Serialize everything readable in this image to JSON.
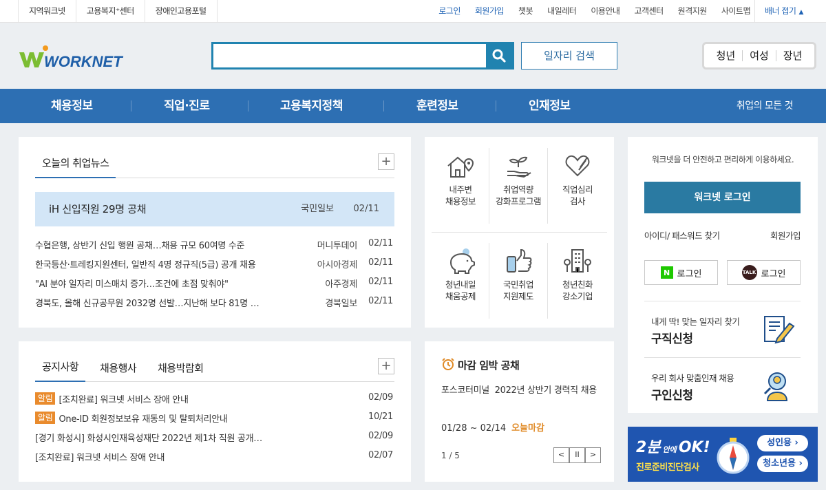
{
  "util": {
    "sites": [
      "지역워크넷",
      "고용복지⁺센터",
      "장애인고용포털"
    ],
    "links": [
      {
        "label": "로그인",
        "highlight": true
      },
      {
        "label": "회원가입",
        "highlight": true
      },
      {
        "label": "챗봇",
        "highlight": false
      },
      {
        "label": "내일레터",
        "highlight": false
      },
      {
        "label": "이용안내",
        "highlight": false
      },
      {
        "label": "고객센터",
        "highlight": false
      },
      {
        "label": "원격지원",
        "highlight": false
      },
      {
        "label": "사이트맵",
        "highlight": false
      }
    ],
    "banner_toggle": "배너 접기"
  },
  "header": {
    "logo": "WORKNET",
    "search_value": "",
    "search_button": "search-icon",
    "job_search": "일자리 검색",
    "age_links": [
      "청년",
      "여성",
      "장년"
    ]
  },
  "gnb": {
    "items": [
      "채용정보",
      "직업·진로",
      "고용복지정책",
      "훈련정보",
      "인재정보"
    ],
    "all": "취업의 모든 것"
  },
  "news": {
    "tab": "오늘의 취업뉴스",
    "more": "+",
    "headline": {
      "title": "iH 신입직원 29명 공채",
      "source": "국민일보",
      "date": "02/11"
    },
    "items": [
      {
        "title": "수협은행, 상반기 신입 행원 공채…채용 규모 60여명 수준",
        "source": "머니투데이",
        "date": "02/11"
      },
      {
        "title": "한국등산·트레킹지원센터, 일반직 4명 정규직(5급) 공개 채용",
        "source": "아시아경제",
        "date": "02/11"
      },
      {
        "title": "\"AI 분야 일자리 미스매치 증가…조건에 초점 맞춰야\"",
        "source": "아주경제",
        "date": "02/11"
      },
      {
        "title": "경북도, 올해 신규공무원 2032명 선발…지난해 보다 81명 …",
        "source": "경북일보",
        "date": "02/11"
      }
    ]
  },
  "services": [
    {
      "label1": "내주변",
      "label2": "채용정보",
      "icon": "house-map-pin-icon"
    },
    {
      "label1": "취업역량",
      "label2": "강화프로그램",
      "icon": "sprout-hand-icon"
    },
    {
      "label1": "직업심리",
      "label2": "검사",
      "icon": "heart-check-icon"
    },
    {
      "label1": "청년내일",
      "label2": "채움공제",
      "icon": "piggy-bank-icon"
    },
    {
      "label1": "국민취업",
      "label2": "지원제도",
      "icon": "thumbs-up-phone-icon"
    },
    {
      "label1": "청년친화",
      "label2": "강소기업",
      "icon": "building-icon"
    }
  ],
  "login": {
    "intro": "워크넷을 더 안전하고 편리하게 이용하세요.",
    "button": "워크넷 로그인",
    "find": "아이디/ 패스워드 찾기",
    "join": "회원가입",
    "naver": {
      "mark": "N",
      "label": "로그인"
    },
    "kakao": {
      "mark": "TALK",
      "label": "로그인"
    },
    "apply_job": {
      "sub": "내게 딱! 맞는 일자리 찾기",
      "main": "구직신청"
    },
    "apply_talent": {
      "sub": "우리 회사 맞춤인재 채용",
      "main": "구인신청"
    }
  },
  "notice": {
    "tabs": [
      "공지사항",
      "채용행사",
      "채용박람회"
    ],
    "more": "+",
    "items": [
      {
        "badge": "알림",
        "title": "[조치완료] 워크넷 서비스 장애 안내",
        "date": "02/09"
      },
      {
        "badge": "알림",
        "title": "One-ID 회원정보보유 재동의 및 탈퇴처리안내",
        "date": "10/21"
      },
      {
        "badge": "",
        "title": "[경기 화성시] 화성시인재육성재단 2022년 제1차 직원 공개…",
        "date": "02/09"
      },
      {
        "badge": "",
        "title": "[조치완료] 워크넷 서비스 장애 안내",
        "date": "02/07"
      }
    ]
  },
  "deadline": {
    "title": "마감 임박 공채",
    "company": "포스코터미널",
    "desc": "2022년 상반기 경력직 채용",
    "range": "01/28 ~ 02/14",
    "status": "오늘마감",
    "page": "1 / 5",
    "prev": "<",
    "pause": "II",
    "next": ">"
  },
  "banner": {
    "line1_big": "2분",
    "line1_small": "안에",
    "line1_rest": "OK!",
    "line2": "진로준비진단검사",
    "btn_adult": "성인용 ›",
    "btn_youth": "청소년용 ›"
  },
  "colors": {
    "brand_blue": "#2d6fb3",
    "search_blue": "#2083b0",
    "login_teal": "#2a7aa2",
    "alert_orange": "#e98b2d",
    "headline_bg": "#d3e6f7"
  }
}
